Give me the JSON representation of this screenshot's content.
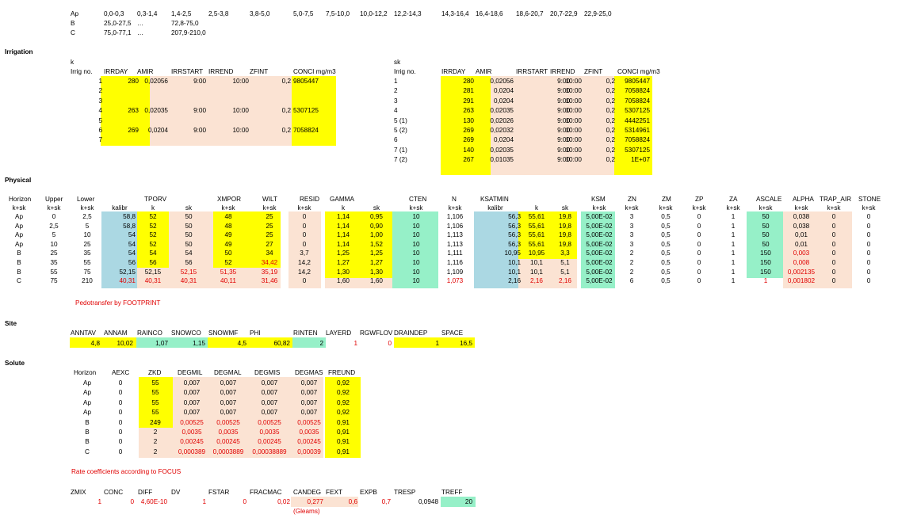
{
  "colors": {
    "yellow": "#ffff00",
    "peach": "#fbe3d3",
    "green": "#96f0c8",
    "blue": "#abd8e3",
    "red": "#e00000"
  },
  "top_rows": [
    [
      "Ap",
      "0,0-0,3",
      "0,3-1,4",
      "1,4-2,5",
      "2,5-3,8",
      "3,8-5,0",
      "5,0-7,5",
      "7,5-10,0",
      "10,0-12,2",
      "12,2-14,3",
      "14,3-16,4",
      "16,4-18,6",
      "18,6-20,7",
      "20,7-22,9",
      "22,9-25,0"
    ],
    [
      "B",
      "25,0-27,5",
      "…",
      "72,8-75,0"
    ],
    [
      "C",
      "75,0-77,1",
      "…",
      "207,9-210,0"
    ]
  ],
  "sections": {
    "irrigation": "Irrigation",
    "physical": "Physical",
    "site": "Site",
    "solute": "Solute"
  },
  "irr_k": {
    "label": "k",
    "headers": [
      "Irrig no.",
      "IRRDAY",
      "AMIR",
      "IRRSTART",
      "IRREND",
      "ZFINT",
      "CONCI mg/m3"
    ],
    "rows": [
      [
        "1",
        "280",
        "0,02056",
        "9:00",
        "10:00",
        "0,2",
        "9805447"
      ],
      [
        "2",
        "",
        "",
        "",
        "",
        "",
        ""
      ],
      [
        "3",
        "",
        "",
        "",
        "",
        "",
        ""
      ],
      [
        "4",
        "263",
        "0,02035",
        "9:00",
        "10:00",
        "0,2",
        "5307125"
      ],
      [
        "5",
        "",
        "",
        "",
        "",
        "",
        ""
      ],
      [
        "6",
        "269",
        "0,0204",
        "9:00",
        "10:00",
        "0,2",
        "7058824"
      ],
      [
        "7",
        "",
        "",
        "",
        "",
        "",
        ""
      ]
    ]
  },
  "irr_sk": {
    "label": "sk",
    "headers": [
      "Irrig no.",
      "IRRDAY",
      "AMIR",
      "IRRSTART",
      "IRREND",
      "ZFINT",
      "CONCI mg/m3"
    ],
    "rows": [
      [
        "1",
        "280",
        "0,02056",
        "9:00",
        "10:00",
        "0,2",
        "9805447"
      ],
      [
        "2",
        "281",
        "0,0204",
        "9:00",
        "10:00",
        "0,2",
        "7058824"
      ],
      [
        "3",
        "291",
        "0,0204",
        "9:00",
        "10:00",
        "0,2",
        "7058824"
      ],
      [
        "4",
        "263",
        "0,02035",
        "9:00",
        "10:00",
        "0,2",
        "5307125"
      ],
      [
        "5 (1)",
        "130",
        "0,02026",
        "9:00",
        "10:00",
        "0,2",
        "4442251"
      ],
      [
        "5 (2)",
        "269",
        "0,02032",
        "9:00",
        "10:00",
        "0,2",
        "5314961"
      ],
      [
        "6",
        "269",
        "0,0204",
        "9:00",
        "10:00",
        "0,2",
        "7058824"
      ],
      [
        "7 (1)",
        "140",
        "0,02035",
        "9:00",
        "10:00",
        "0,2",
        "5307125"
      ],
      [
        "7 (2)",
        "267",
        "0,01035",
        "9:00",
        "10:00",
        "0,2",
        "1E+07"
      ]
    ]
  },
  "phys": {
    "headers1": [
      "Horizon",
      "Upper",
      "Lower",
      "",
      "TPORV",
      "",
      "XMPOR",
      "WILT",
      "RESID",
      "GAMMA",
      "",
      "CTEN",
      "N",
      "KSATMIN",
      "",
      "",
      "KSM",
      "ZN",
      "ZM",
      "ZP",
      "ZA",
      "ASCALE",
      "ALPHA",
      "TRAP_AIR",
      "STONE"
    ],
    "headers2": [
      "k+sk",
      "k+sk",
      "k+sk",
      "kalibr",
      "k",
      "sk",
      "k+sk",
      "k+sk",
      "k+sk",
      "k",
      "sk",
      "k+sk",
      "k+sk",
      "kalibr",
      "k",
      "sk",
      "k+sk",
      "k+sk",
      "k+sk",
      "k+sk",
      "k+sk",
      "k+sk",
      "k+sk",
      "k+sk",
      "k+sk"
    ],
    "rows": [
      [
        "Ap",
        "0",
        "2,5",
        "58,8",
        "52",
        "50",
        "48",
        "25",
        "0",
        "1,14",
        "0,95",
        "10",
        "1,106",
        "56,3",
        "55,61",
        "19,8",
        "5,00E-02",
        "3",
        "0,5",
        "0",
        "1",
        "50",
        "0,038",
        "0",
        "0"
      ],
      [
        "Ap",
        "2,5",
        "5",
        "58,8",
        "52",
        "50",
        "48",
        "25",
        "0",
        "1,14",
        "0,90",
        "10",
        "1,106",
        "56,3",
        "55,61",
        "19,8",
        "5,00E-02",
        "3",
        "0,5",
        "0",
        "1",
        "50",
        "0,038",
        "0",
        "0"
      ],
      [
        "Ap",
        "5",
        "10",
        "54",
        "52",
        "50",
        "49",
        "25",
        "0",
        "1,14",
        "1,00",
        "10",
        "1,113",
        "56,3",
        "55,61",
        "19,8",
        "5,00E-02",
        "3",
        "0,5",
        "0",
        "1",
        "50",
        "0,01",
        "0",
        "0"
      ],
      [
        "Ap",
        "10",
        "25",
        "54",
        "52",
        "50",
        "49",
        "27",
        "0",
        "1,14",
        "1,52",
        "10",
        "1,113",
        "56,3",
        "55,61",
        "19,8",
        "5,00E-02",
        "3",
        "0,5",
        "0",
        "1",
        "50",
        "0,01",
        "0",
        "0"
      ],
      [
        "B",
        "25",
        "35",
        "54",
        "54",
        "54",
        "50",
        "34",
        "3,7",
        "1,25",
        "1,25",
        "10",
        "1,111",
        "10,95",
        "10,95",
        "3,3",
        "5,00E-02",
        "2",
        "0,5",
        "0",
        "1",
        "150",
        "0,003",
        "0",
        "0"
      ],
      [
        "B",
        "35",
        "55",
        "56",
        "56",
        "56",
        "52",
        "34,42",
        "14,2",
        "1,27",
        "1,27",
        "10",
        "1,116",
        "10,1",
        "10,1",
        "5,1",
        "5,00E-02",
        "2",
        "0,5",
        "0",
        "1",
        "150",
        "0,008",
        "0",
        "0"
      ],
      [
        "B",
        "55",
        "75",
        "52,15",
        "52,15",
        "52,15",
        "51,35",
        "35,19",
        "14,2",
        "1,30",
        "1,30",
        "10",
        "1,109",
        "10,1",
        "10,1",
        "5,1",
        "5,00E-02",
        "2",
        "0,5",
        "0",
        "1",
        "150",
        "0,002135",
        "0",
        "0"
      ],
      [
        "C",
        "75",
        "210",
        "40,31",
        "40,31",
        "40,31",
        "40,11",
        "31,46",
        "0",
        "1,60",
        "1,60",
        "10",
        "1,073",
        "2,16",
        "2,16",
        "2,16",
        "5,00E-02",
        "6",
        "0,5",
        "0",
        "1",
        "1",
        "0,001802",
        "0",
        "0"
      ]
    ],
    "note": "Pedotransfer by FOOTPRINT"
  },
  "site": {
    "headers": [
      "ANNTAV",
      "ANNAM",
      "RAINCO",
      "SNOWCO",
      "SNOWMF",
      "PHI",
      "RINTEN",
      "LAYERD",
      "RGWFLOV",
      "DRAINDEP",
      "SPACE"
    ],
    "values": [
      "4,8",
      "10,02",
      "1,07",
      "1,15",
      "4,5",
      "60,82",
      "2",
      "1",
      "0",
      "1",
      "16,5"
    ]
  },
  "solute": {
    "headers": [
      "Horizon",
      "AEXC",
      "ZKD",
      "DEGMIL",
      "DEGMAL",
      "DEGMIS",
      "DEGMAS",
      "FREUND"
    ],
    "rows": [
      [
        "Ap",
        "0",
        "55",
        "0,007",
        "0,007",
        "0,007",
        "0,007",
        "0,92"
      ],
      [
        "Ap",
        "0",
        "55",
        "0,007",
        "0,007",
        "0,007",
        "0,007",
        "0,92"
      ],
      [
        "Ap",
        "0",
        "55",
        "0,007",
        "0,007",
        "0,007",
        "0,007",
        "0,92"
      ],
      [
        "Ap",
        "0",
        "55",
        "0,007",
        "0,007",
        "0,007",
        "0,007",
        "0,92"
      ],
      [
        "B",
        "0",
        "249",
        "0,00525",
        "0,00525",
        "0,00525",
        "0,00525",
        "0,91"
      ],
      [
        "B",
        "0",
        "2",
        "0,0035",
        "0,0035",
        "0,0035",
        "0,0035",
        "0,91"
      ],
      [
        "B",
        "0",
        "2",
        "0,00245",
        "0,00245",
        "0,00245",
        "0,00245",
        "0,91"
      ],
      [
        "C",
        "0",
        "2",
        "0,000389",
        "0,0003889",
        "0,00038889",
        "0,00039",
        "0,91"
      ]
    ],
    "note": "Rate coefficients according to FOCUS"
  },
  "bottom": {
    "headers": [
      "ZMIX",
      "CONC",
      "DIFF",
      "DV",
      "FSTAR",
      "FRACMAC",
      "CANDEG",
      "FEXT",
      "EXPB",
      "TRESP",
      "TREFF"
    ],
    "values": [
      "1",
      "0",
      "4,60E-10",
      "1",
      "0",
      "0,02",
      "0,277",
      "0,6",
      "0,7",
      "0,0948",
      "20"
    ],
    "gleams": "(Gleams)"
  }
}
